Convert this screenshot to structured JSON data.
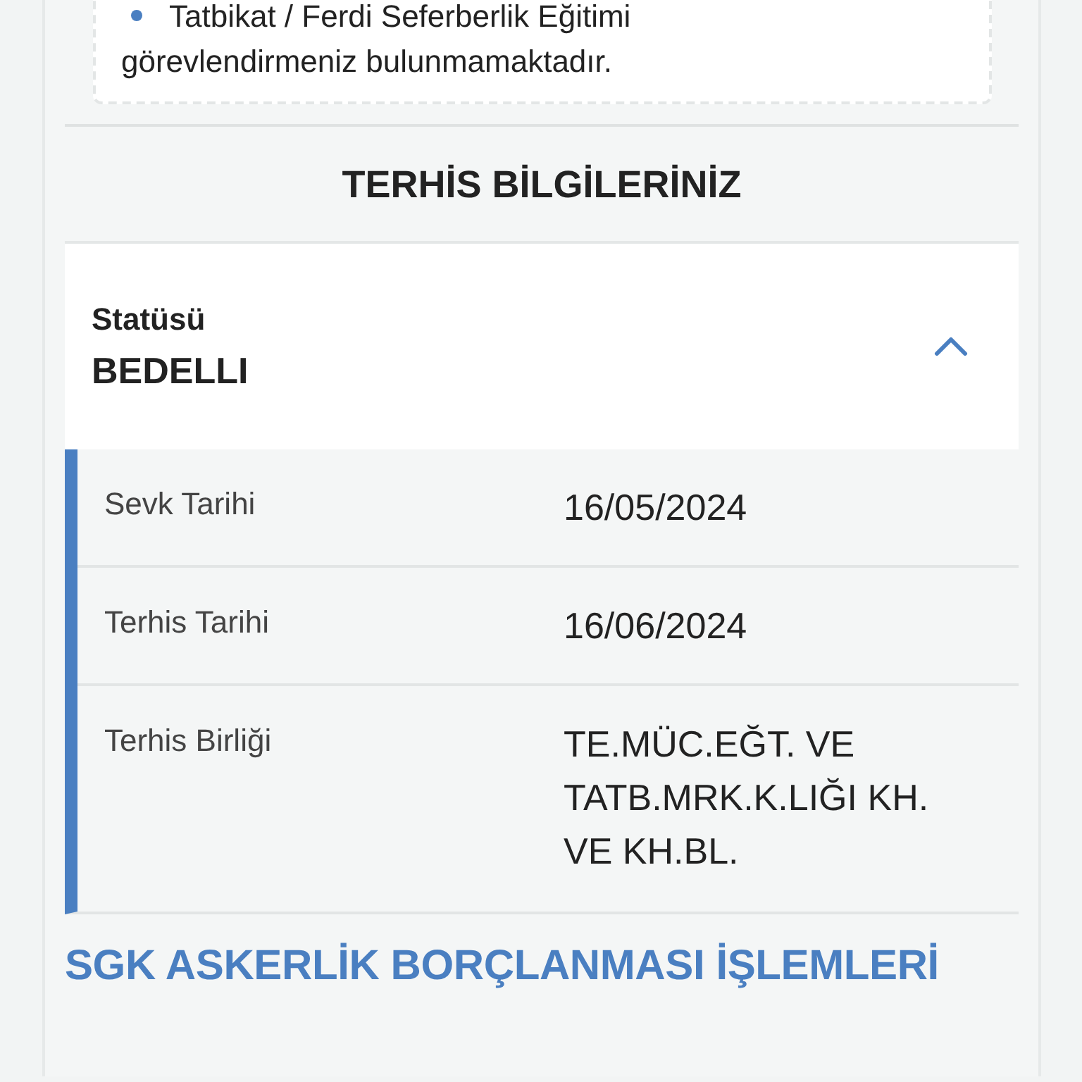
{
  "notice": {
    "lines": [
      "Tatbikat / Ferdi Seferberlik Eğitimi",
      "görevlendirmeniz bulunmamaktadır."
    ]
  },
  "discharge": {
    "title": "TERHİS BİLGİLERİNİZ",
    "status_label": "Statüsü",
    "status_value": "BEDELLI",
    "expanded": true,
    "rows": [
      {
        "label": "Sevk Tarihi",
        "value": "16/05/2024"
      },
      {
        "label": "Terhis Tarihi",
        "value": "16/06/2024"
      },
      {
        "label": "Terhis Birliği",
        "value": "TE.MÜC.EĞT. VE TATB.MRK.K.LIĞI KH. VE KH.BL."
      }
    ]
  },
  "sgk": {
    "title": "SGK ASKERLİK BORÇLANMASI İŞLEMLERİ"
  }
}
